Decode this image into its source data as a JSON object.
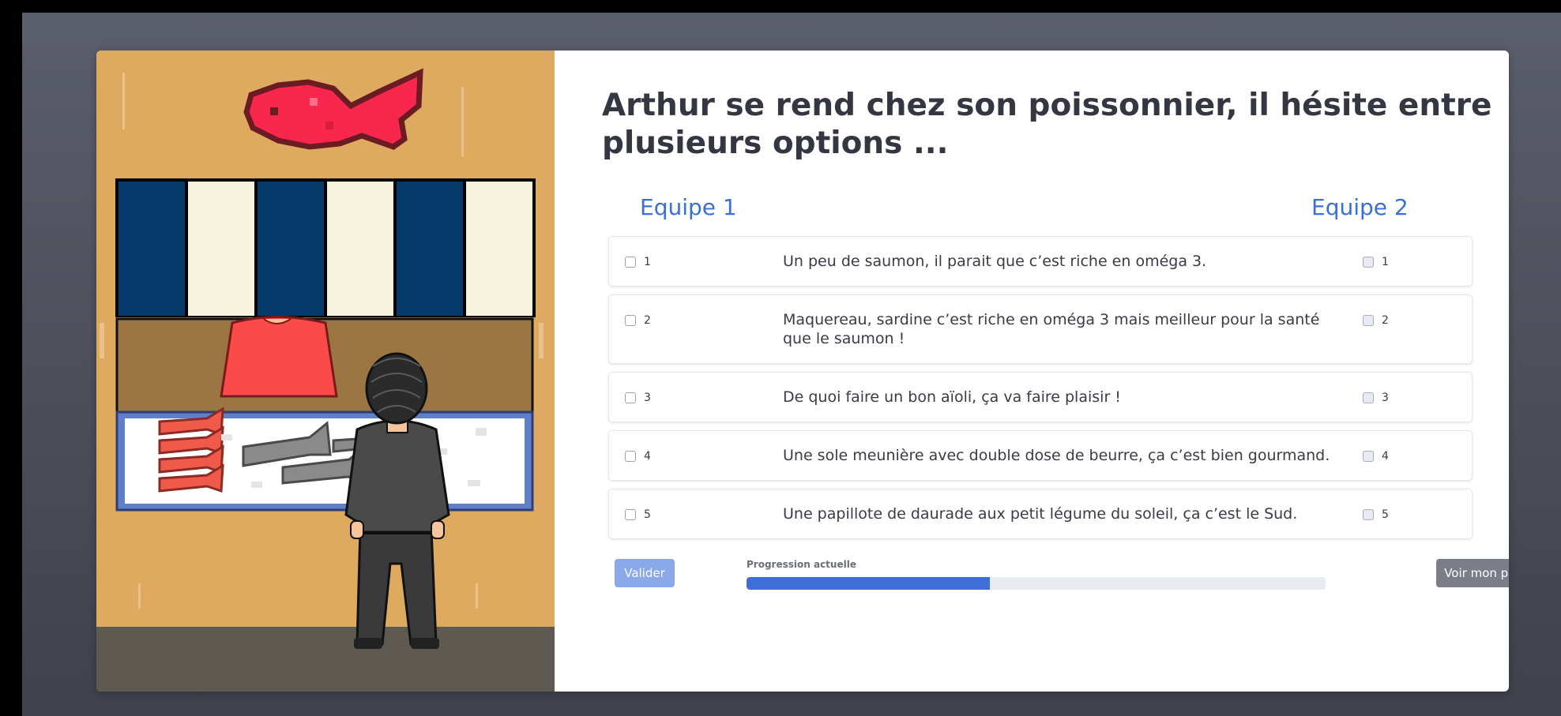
{
  "question": "Arthur se rend chez son poissonnier, il hésite entre plusieurs options ...",
  "teams": {
    "team1": "Equipe 1",
    "team2": "Equipe 2"
  },
  "answers": [
    {
      "left": "1",
      "text": "Un peu de saumon, il parait que c’est riche en oméga 3.",
      "right": "1"
    },
    {
      "left": "2",
      "text": "Maquereau, sardine c’est riche en oméga 3 mais meilleur pour la santé que le saumon !",
      "right": "2"
    },
    {
      "left": "3",
      "text": "De quoi faire un bon aïoli, ça va faire plaisir !",
      "right": "3"
    },
    {
      "left": "4",
      "text": "Une sole meunière avec double dose de beurre, ça c’est bien gourmand.",
      "right": "4"
    },
    {
      "left": "5",
      "text": "Une papillote de daurade aux petit légume du soleil, ça c’est le Sud.",
      "right": "5"
    }
  ],
  "buttons": {
    "validate": "Valider",
    "profile": "Voir mon profil"
  },
  "progress": {
    "label": "Progression actuelle",
    "fraction": 0.42
  },
  "colors": {
    "accent": "#3b6fd8",
    "wall": "#deaa60",
    "awning_blue": "#063a6b",
    "awning_cream": "#f5f3dc",
    "sign_fish": "#f9274d",
    "shirt": "#fa4a4a"
  }
}
